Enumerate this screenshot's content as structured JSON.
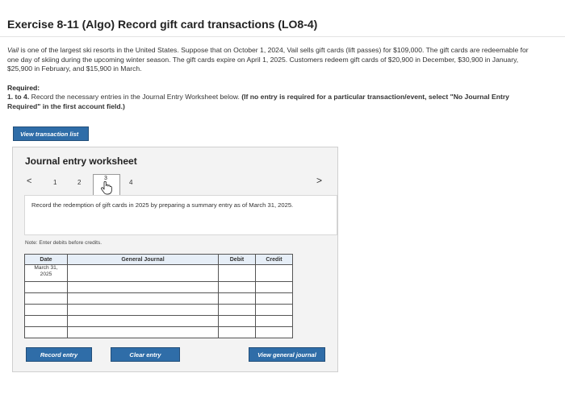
{
  "header": {
    "title": "Exercise 8-11 (Algo) Record gift card transactions (LO8-4)"
  },
  "problem": {
    "intro_company": "Vail",
    "intro_rest": " is one of the largest ski resorts in the United States. Suppose that on October 1, 2024, Vail sells gift cards (lift passes) for $109,000. The gift cards are redeemable for one day of skiing during the upcoming winter season. The gift cards expire on April 1, 2025. Customers redeem gift cards of $20,900 in December, $30,900 in January, $25,900 in February, and $15,900 in March.",
    "required_heading": "Required:",
    "required_num": "1. to 4.",
    "required_text": " Record the necessary entries in the Journal Entry Worksheet below. ",
    "required_bold": "(If no entry is required for a particular transaction/event, select \"No Journal Entry Required\" in the first account field.)"
  },
  "buttons": {
    "view_transaction_list": "View transaction list",
    "record_entry": "Record entry",
    "clear_entry": "Clear entry",
    "view_general_journal": "View general journal"
  },
  "worksheet": {
    "title": "Journal entry worksheet",
    "pages": [
      "1",
      "2",
      "3",
      "4"
    ],
    "active_page": "3",
    "prev_symbol": "<",
    "next_symbol": ">",
    "instruction": "Record the redemption of gift cards in 2025 by preparing a summary entry as of March 31, 2025.",
    "note": "Note: Enter debits before credits."
  },
  "journal": {
    "headers": {
      "date": "Date",
      "general_journal": "General Journal",
      "debit": "Debit",
      "credit": "Credit"
    },
    "first_date_line1": "March 31,",
    "first_date_line2": "2025"
  },
  "colors": {
    "button_blue": "#2f6da8",
    "header_fill": "#e6eef7"
  }
}
